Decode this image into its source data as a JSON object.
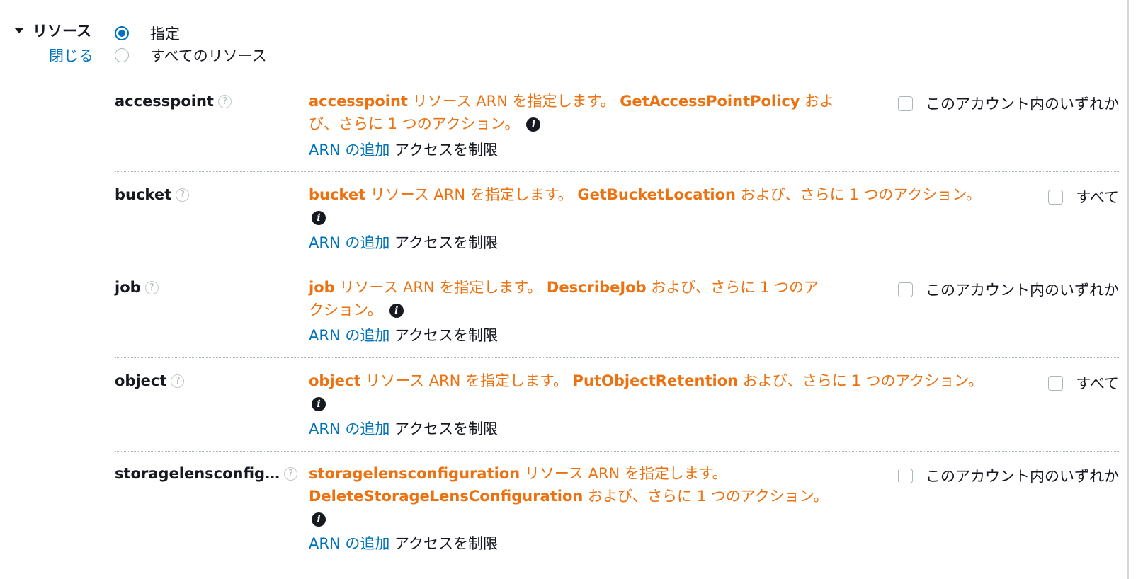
{
  "section": {
    "title": "リソース",
    "collapse_label": "閉じる",
    "radio_specified": "指定",
    "radio_all": "すべてのリソース"
  },
  "arn_add_label": "ARN の追加",
  "restrict_label": "アクセスを制限",
  "rows": [
    {
      "name": "accesspoint",
      "desc_res": "accesspoint",
      "desc_mid": " リソース ARN を指定します。 ",
      "desc_action": "GetAccessPointPolicy",
      "desc_l1_tail": " およ",
      "desc_l2": "び、さらに 1 つのアクション。",
      "checkbox_label": "このアカウント内のいずれか"
    },
    {
      "name": "bucket",
      "desc_res": "bucket",
      "desc_mid": " リソース ARN を指定します。 ",
      "desc_action": "GetBucketLocation",
      "desc_l1_tail": " および、さらに 1 つのアクション。",
      "checkbox_label": "すべて"
    },
    {
      "name": "job",
      "desc_res": "job",
      "desc_mid": " リソース ARN を指定します。 ",
      "desc_action": "DescribeJob",
      "desc_l1_tail": " および、さらに 1 つのア",
      "desc_l2": "クション。",
      "checkbox_label": "このアカウント内のいずれか"
    },
    {
      "name": "object",
      "desc_res": "object",
      "desc_mid": " リソース ARN を指定します。 ",
      "desc_action": "PutObjectRetention",
      "desc_l1_tail": " および、さらに 1 つのアクション。",
      "checkbox_label": "すべて"
    },
    {
      "name": "storagelensconfig…",
      "desc_res": "storagelensconfiguration",
      "desc_mid": " リソース ARN を指定します。",
      "desc_action": "DeleteStorageLensConfiguration",
      "desc_l2_tail": " および、さらに 1 つのアクション。",
      "checkbox_label": "このアカウント内のいずれか"
    }
  ]
}
